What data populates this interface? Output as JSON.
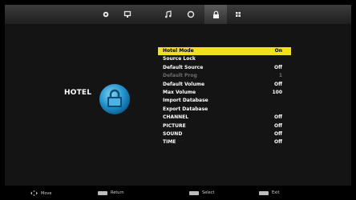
{
  "top_tabs": [
    {
      "icon": "picture-icon",
      "active": false
    },
    {
      "icon": "monitor-icon",
      "active": false
    },
    {
      "icon": "music-note-icon",
      "active": false
    },
    {
      "icon": "clock-icon",
      "active": false
    },
    {
      "icon": "lock-icon",
      "active": true
    },
    {
      "icon": "grid-icon",
      "active": false
    }
  ],
  "section": {
    "title": "HOTEL",
    "icon": "hotel-icon"
  },
  "menu": {
    "items": [
      {
        "label": "Hotel Mode",
        "value": "On",
        "selected": true,
        "disabled": false
      },
      {
        "label": "Source Lock",
        "value": "",
        "selected": false,
        "disabled": false
      },
      {
        "label": "Default Source",
        "value": "Off",
        "selected": false,
        "disabled": false
      },
      {
        "label": "Default Prog",
        "value": "1",
        "selected": false,
        "disabled": true
      },
      {
        "label": "Default Volume",
        "value": "Off",
        "selected": false,
        "disabled": false
      },
      {
        "label": "Max Volume",
        "value": "100",
        "selected": false,
        "disabled": false
      },
      {
        "label": "Import Database",
        "value": "",
        "selected": false,
        "disabled": false
      },
      {
        "label": "Export Database",
        "value": "",
        "selected": false,
        "disabled": false
      },
      {
        "label": "CHANNEL",
        "value": "Off",
        "selected": false,
        "disabled": false
      },
      {
        "label": "PICTURE",
        "value": "Off",
        "selected": false,
        "disabled": false
      },
      {
        "label": "SOUND",
        "value": "Off",
        "selected": false,
        "disabled": false
      },
      {
        "label": "TIME",
        "value": "Off",
        "selected": false,
        "disabled": false
      }
    ]
  },
  "footer": {
    "move": "Move",
    "return_key": "MENU",
    "return": "Return",
    "select_key": "ENTER",
    "select": "Select",
    "exit_key": "EXIT",
    "exit": "Exit"
  },
  "colors": {
    "highlight": "#f0e01e",
    "background": "#141414"
  }
}
